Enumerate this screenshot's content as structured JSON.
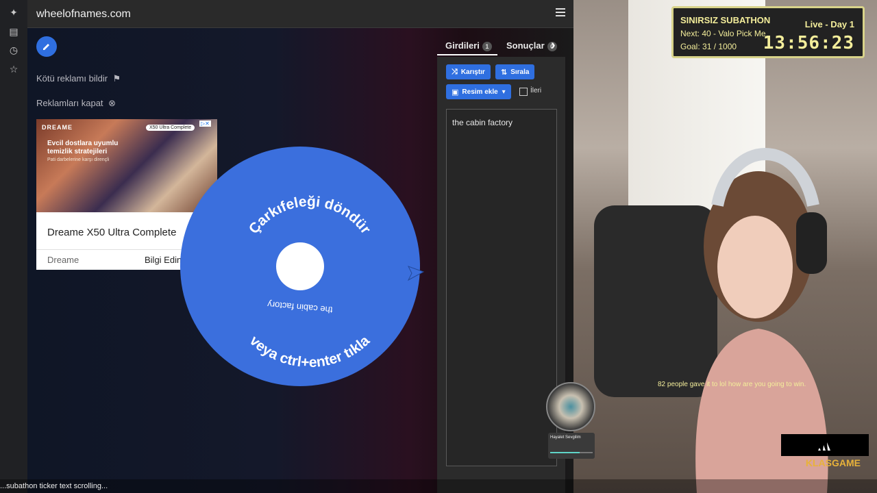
{
  "site": {
    "title": "wheelofnames.com"
  },
  "sidebar": {
    "report_ad": "Kötü reklamı bildir",
    "close_ads": "Reklamları kapat"
  },
  "ad": {
    "brand": "DREAME",
    "tag": "X50 Ultra Complete",
    "headline": "Evcil dostlara uyumlu temizlik stratejileri",
    "sub": "Pati darbelerine karşı dirençli",
    "title": "Dreame X50 Ultra Complete",
    "advertiser": "Dreame",
    "cta": "Bilgi Edin"
  },
  "wheel": {
    "spin_prompt_top": "Çarkıfeleği döndür",
    "spin_prompt_bottom": "veya ctrl+enter tıkla",
    "entry_label": "the cabin factory",
    "color": "#3b6fdd"
  },
  "panel": {
    "tabs": [
      {
        "label": "Girdileri",
        "count": "1"
      },
      {
        "label": "Sonuçlar",
        "count": "0"
      }
    ],
    "buttons": {
      "shuffle": "Karıştır",
      "sort": "Sırala",
      "add_image": "Resim ekle"
    },
    "advanced_label": "İleri",
    "entries": [
      "the cabin factory"
    ]
  },
  "overlay": {
    "title": "SINIRSIZ SUBATHON",
    "next": "Next: 40 - Valo Pick Me",
    "goal": "Goal: 31 / 1000",
    "live": "Live - Day 1",
    "timer": "13:56:23"
  },
  "chat": {
    "message": "82 people gave it to lol how are you going to win."
  },
  "music": {
    "title": "Hayalet Sevgilim",
    "progress": 0.7
  },
  "brand": {
    "logo": "KLASGAME"
  },
  "ticker": {
    "text": "...subathon ticker text scrolling..."
  },
  "colors": {
    "accent": "#2f6fe0",
    "overlay_text": "#f4ee9b",
    "overlay_border": "#d8d38a"
  }
}
